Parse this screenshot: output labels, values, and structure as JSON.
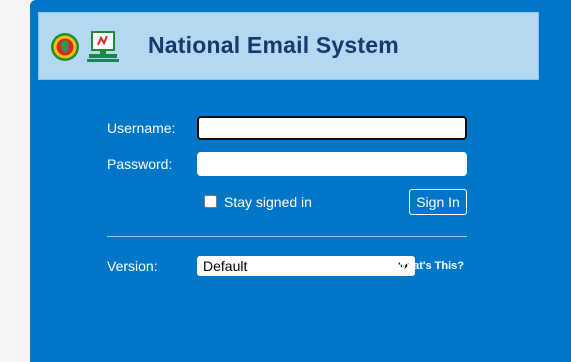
{
  "banner": {
    "title": "National Email System",
    "emblem_icon": "bangladesh-emblem-icon",
    "logo_icon": "computer-terminal-icon"
  },
  "login": {
    "username_label": "Username:",
    "username_value": "",
    "password_label": "Password:",
    "password_value": "",
    "stay_signed_in_label": "Stay signed in",
    "stay_signed_in_checked": false,
    "sign_in_label": "Sign In"
  },
  "version": {
    "label": "Version:",
    "selected": "Default",
    "whats_this": "What's This?"
  },
  "colors": {
    "panel": "#0076c9",
    "banner": "#b3d8f2",
    "title": "#163a6a"
  }
}
